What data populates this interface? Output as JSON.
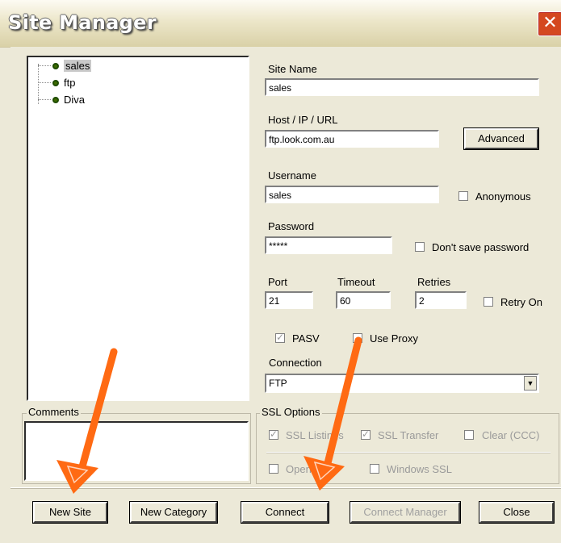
{
  "window": {
    "title": "Site Manager",
    "close_glyph": "✕"
  },
  "tree": {
    "items": [
      {
        "label": "sales",
        "selected": true
      },
      {
        "label": "ftp",
        "selected": false
      },
      {
        "label": "Diva",
        "selected": false
      }
    ]
  },
  "form": {
    "site_name_label": "Site Name",
    "site_name_value": "sales",
    "host_label": "Host / IP / URL",
    "host_value": "ftp.look.com.au",
    "advanced_button": "Advanced",
    "username_label": "Username",
    "username_value": "sales",
    "anonymous_label": "Anonymous",
    "password_label": "Password",
    "password_value": "*****",
    "dont_save_label": "Don't save password",
    "port_label": "Port",
    "port_value": "21",
    "timeout_label": "Timeout",
    "timeout_value": "60",
    "retries_label": "Retries",
    "retries_value": "2",
    "retry_on_label": "Retry On",
    "pasv_label": "PASV",
    "use_proxy_label": "Use Proxy",
    "connection_label": "Connection",
    "connection_value": "FTP"
  },
  "comments": {
    "label": "Comments"
  },
  "ssl": {
    "label": "SSL Options",
    "ssl_listings": "SSL Listings",
    "ssl_transfer": "SSL Transfer",
    "clear_ccc": "Clear (CCC)",
    "openssl": "OpenSSL",
    "windows_ssl": "Windows SSL"
  },
  "buttons": {
    "new_site": "New Site",
    "new_category": "New Category",
    "connect": "Connect",
    "connect_manager": "Connect Manager",
    "close": "Close"
  },
  "colors": {
    "arrow": "#ff6a13",
    "titlebar": "#ece6c9",
    "close": "#d4471f"
  }
}
